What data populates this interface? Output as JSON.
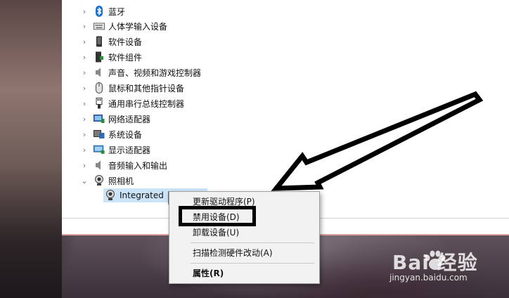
{
  "tree": {
    "items": [
      {
        "label": "蓝牙",
        "icon": "bluetooth-icon",
        "expanded": false
      },
      {
        "label": "人体学输入设备",
        "icon": "keyboard-icon",
        "expanded": false
      },
      {
        "label": "软件设备",
        "icon": "phone-device-icon",
        "expanded": false
      },
      {
        "label": "软件组件",
        "icon": "software-component-icon",
        "expanded": false
      },
      {
        "label": "声音、视频和游戏控制器",
        "icon": "speaker-icon",
        "expanded": false
      },
      {
        "label": "鼠标和其他指针设备",
        "icon": "mouse-icon",
        "expanded": false
      },
      {
        "label": "通用串行总线控制器",
        "icon": "usb-icon",
        "expanded": false
      },
      {
        "label": "网络适配器",
        "icon": "network-adapter-icon",
        "expanded": false
      },
      {
        "label": "系统设备",
        "icon": "system-device-icon",
        "expanded": false
      },
      {
        "label": "显示适配器",
        "icon": "display-adapter-icon",
        "expanded": false
      },
      {
        "label": "音频输入和输出",
        "icon": "audio-io-icon",
        "expanded": false
      },
      {
        "label": "照相机",
        "icon": "camera-icon",
        "expanded": true
      }
    ],
    "child": {
      "label": "Integrated",
      "icon": "webcam-icon",
      "selected": true
    }
  },
  "context_menu": {
    "items": [
      {
        "label": "更新驱动程序(P)",
        "bold": false
      },
      {
        "label": "禁用设备(D)",
        "bold": false,
        "annotated": true
      },
      {
        "label": "卸载设备(U)",
        "bold": false
      },
      {
        "label": "扫描检测硬件改动(A)",
        "bold": false
      },
      {
        "label": "属性(R)",
        "bold": true
      }
    ]
  },
  "watermark": {
    "brand": "Bai 经验",
    "url": "jingyan.baidu.com"
  },
  "colors": {
    "selection": "#cce4f7",
    "menu_background": "#f2f2f2",
    "annotation": "#000000"
  }
}
